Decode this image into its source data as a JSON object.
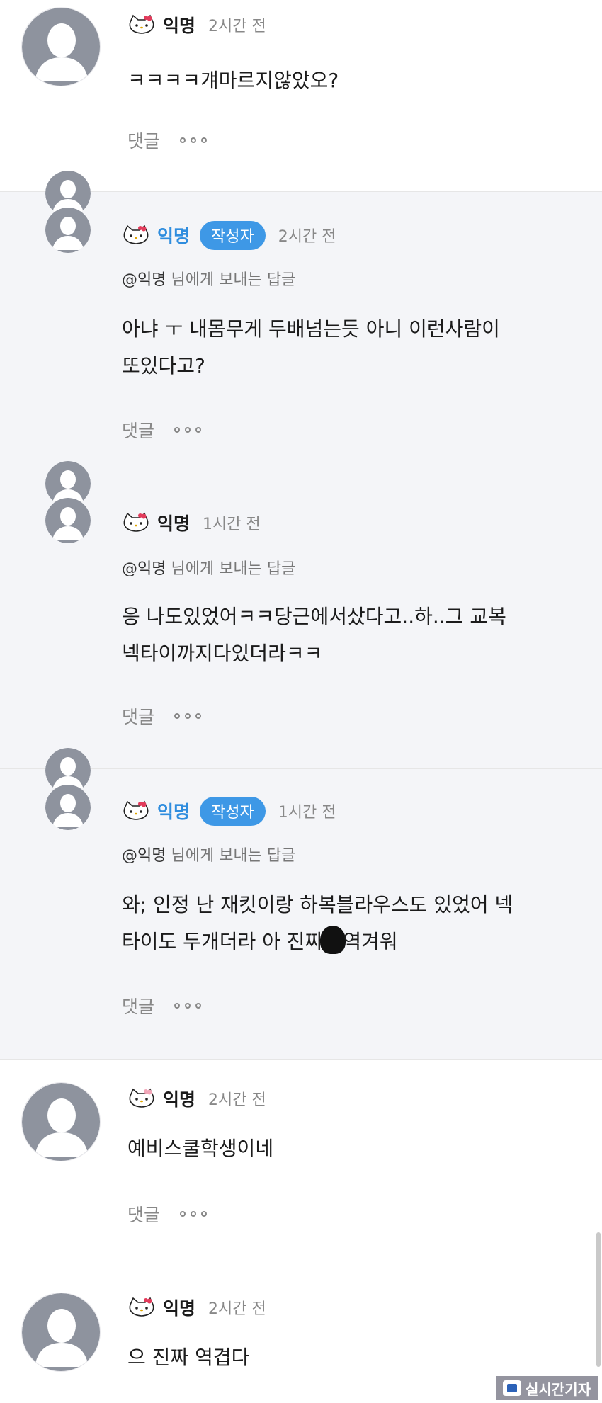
{
  "comments": [
    {
      "name": "익명",
      "time": "2시간 전",
      "text": "ㅋㅋㅋㅋ걔마르지않았오?",
      "reply_label": "댓글"
    },
    {
      "name": "익명",
      "badge": "작성자",
      "time": "2시간 전",
      "reply_to_user": "@익명",
      "reply_to_suffix": " 님에게 보내는 답글",
      "text_line1": "아냐 ㅜ 내몸무게 두배넘는듯 아니 이런사람이",
      "text_line2": "또있다고?",
      "reply_label": "댓글"
    },
    {
      "name": "익명",
      "time": "1시간 전",
      "reply_to_user": "@익명",
      "reply_to_suffix": " 님에게 보내는 답글",
      "text_line1": "응 나도있었어ㅋㅋ당근에서샀다고..하..그 교복",
      "text_line2": "넥타이까지다있더라ㅋㅋ",
      "reply_label": "댓글"
    },
    {
      "name": "익명",
      "badge": "작성자",
      "time": "1시간 전",
      "reply_to_user": "@익명",
      "reply_to_suffix": " 님에게 보내는 답글",
      "text_line1": "와; 인정 난 재킷이랑 하복블라우스도 있었어 넥",
      "text_line2a": "타이도 두개더라 아 진짜",
      "text_line2b": "역겨워",
      "reply_label": "댓글"
    },
    {
      "name": "익명",
      "time": "2시간 전",
      "text": "예비스쿨학생이네",
      "reply_label": "댓글"
    },
    {
      "name": "익명",
      "time": "2시간 전",
      "text": "으 진짜 역겹다"
    }
  ],
  "watermark": "실시간기자",
  "colors": {
    "author_name": "#2f8dde",
    "author_badge": "#3e98e6",
    "reply_background": "#f4f5f8",
    "avatar_silhouette": "#8e939e"
  },
  "icons": [
    "default-avatar-icon",
    "hello-kitty-icon",
    "more-options-icon"
  ]
}
